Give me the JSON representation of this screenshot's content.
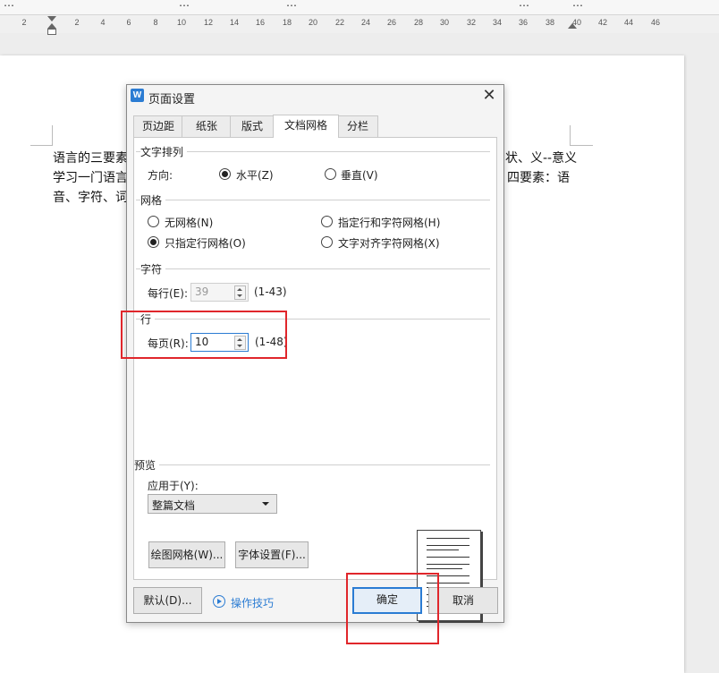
{
  "top_strip": {
    "fragments": [
      "…",
      "…",
      "…",
      "…",
      "…"
    ]
  },
  "ruler": {
    "ticks": [
      "2",
      "2",
      "4",
      "6",
      "8",
      "10",
      "12",
      "14",
      "16",
      "18",
      "20",
      "22",
      "24",
      "26",
      "28",
      "30",
      "32",
      "34",
      "36",
      "38",
      "40",
      "42",
      "44",
      "46"
    ]
  },
  "document": {
    "line1_left": "语言的三要素",
    "line1_right": "状、义--意义",
    "line2_left": "学习一门语言",
    "line2_right": "四要素：语",
    "line3_left": "音、字符、词"
  },
  "dialog": {
    "title": "页面设置",
    "close_glyph": "✕",
    "app_icon_letter": "W",
    "tabs": [
      "页边距",
      "纸张",
      "版式",
      "文档网格",
      "分栏"
    ],
    "active_tab": "文档网格",
    "text_direction": {
      "group_label": "文字排列",
      "direction_label": "方向:",
      "horizontal": "水平(Z)",
      "vertical": "垂直(V)",
      "selected": "水平(Z)"
    },
    "grid": {
      "group_label": "网格",
      "options": [
        "无网格(N)",
        "指定行和字符网格(H)",
        "只指定行网格(O)",
        "文字对齐字符网格(X)"
      ],
      "selected": "只指定行网格(O)"
    },
    "chars": {
      "group_label": "字符",
      "per_line_label": "每行(E):",
      "per_line_value": "39",
      "range": "(1-43)"
    },
    "lines": {
      "group_label": "行",
      "per_page_label": "每页(R):",
      "per_page_value": "10",
      "range": "(1-48)"
    },
    "preview": {
      "group_label": "预览",
      "apply_to_label": "应用于(Y):",
      "apply_to_value": "整篇文档"
    },
    "buttons": {
      "draw_grid": "绘图网格(W)...",
      "font_settings": "字体设置(F)...",
      "default": "默认(D)...",
      "tips": "操作技巧",
      "ok": "确定",
      "cancel": "取消"
    }
  },
  "colors": {
    "accent": "#2b7cd3",
    "highlight": "#e0262b"
  }
}
